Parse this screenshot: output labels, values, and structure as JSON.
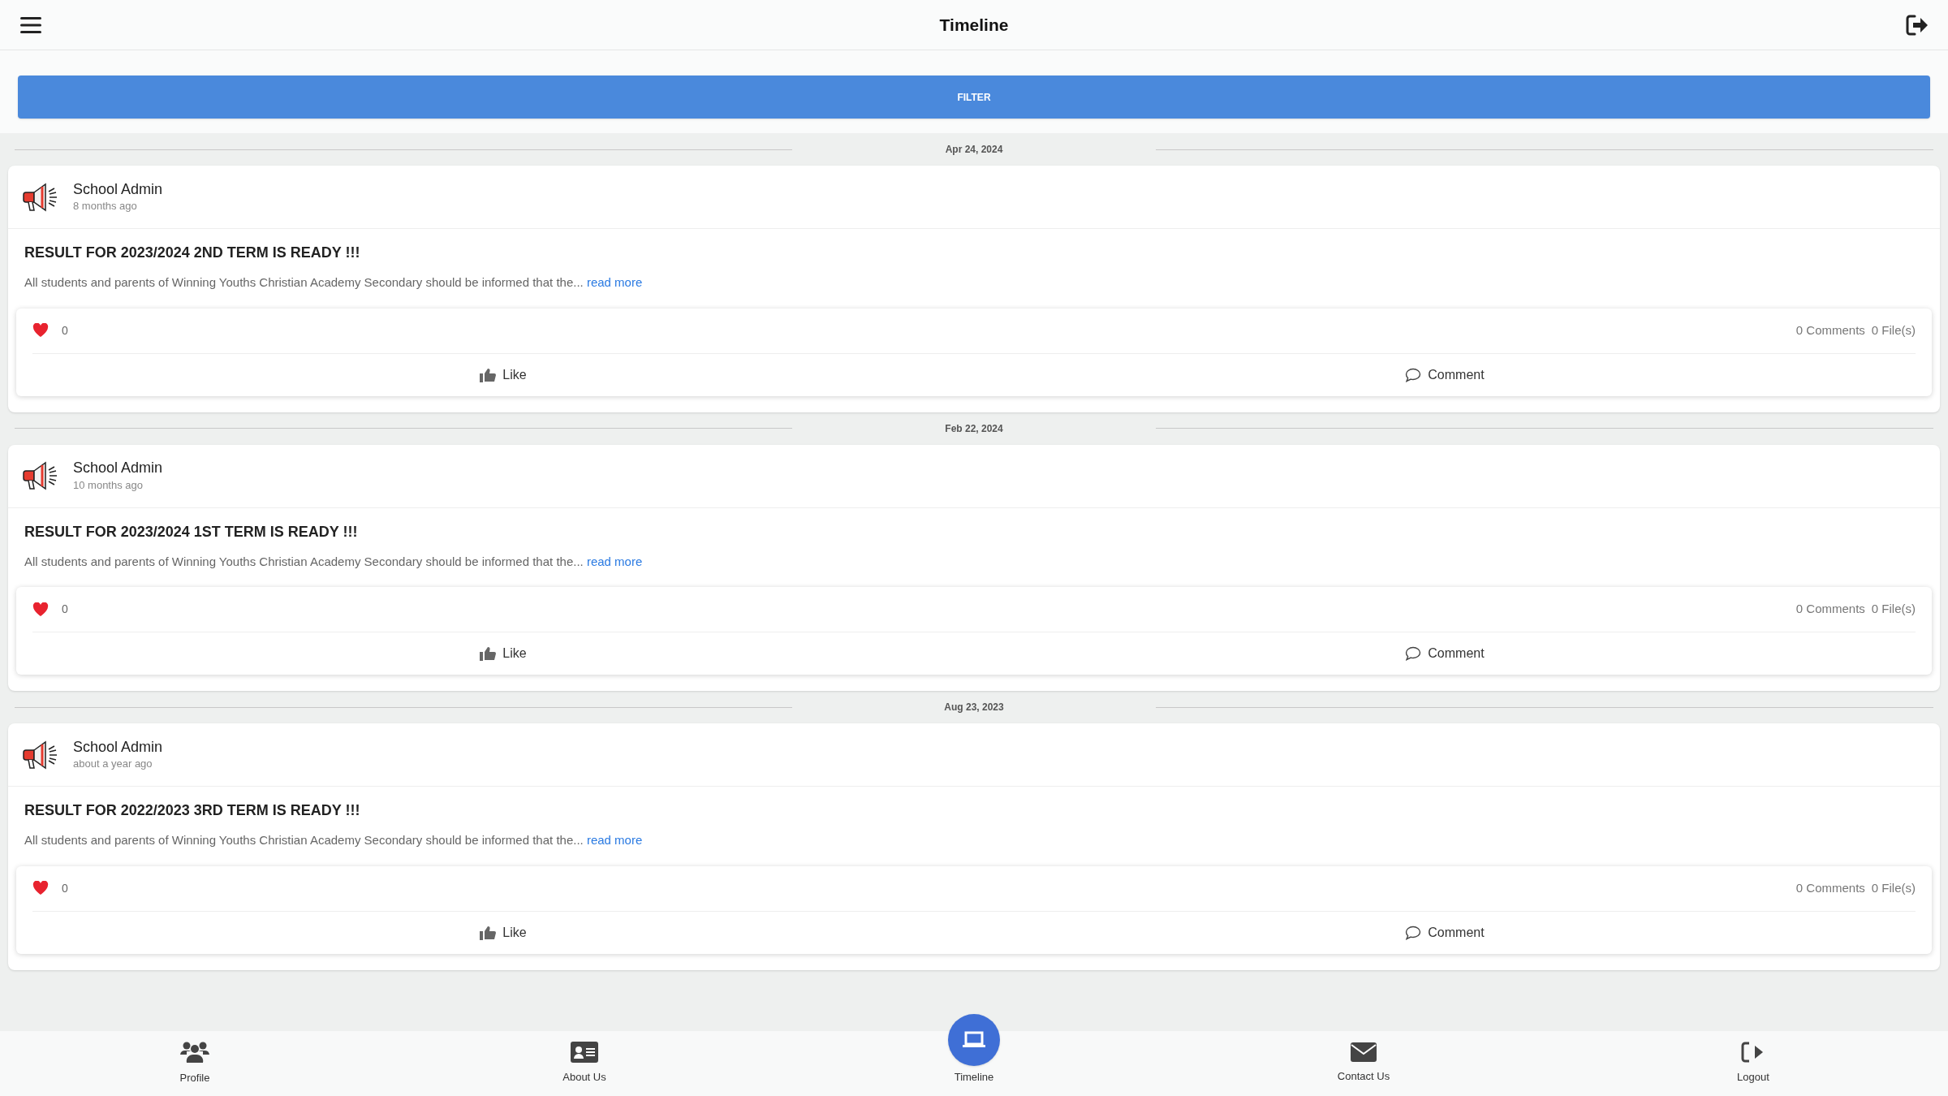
{
  "header": {
    "title": "Timeline"
  },
  "filter": {
    "label": "FILTER"
  },
  "posts": [
    {
      "date": "Apr 24, 2024",
      "author": "School Admin",
      "time": "8 months ago",
      "title": "RESULT FOR 2023/2024 2ND TERM IS READY !!!",
      "excerpt": "All students and parents of Winning Youths Christian Academy Secondary should be informed that the...",
      "read_more": "read more",
      "likes": "0",
      "comments": "0 Comments",
      "files": "0 File(s)",
      "like_label": "Like",
      "comment_label": "Comment"
    },
    {
      "date": "Feb 22, 2024",
      "author": "School Admin",
      "time": "10 months ago",
      "title": "RESULT FOR 2023/2024 1ST TERM IS READY !!!",
      "excerpt": "All students and parents of Winning Youths Christian Academy Secondary should be informed that the...",
      "read_more": "read more",
      "likes": "0",
      "comments": "0 Comments",
      "files": "0 File(s)",
      "like_label": "Like",
      "comment_label": "Comment"
    },
    {
      "date": "Aug 23, 2023",
      "author": "School Admin",
      "time": "about a year ago",
      "title": "RESULT FOR 2022/2023 3RD TERM IS READY !!!",
      "excerpt": "All students and parents of Winning Youths Christian Academy Secondary should be informed that the...",
      "read_more": "read more",
      "likes": "0",
      "comments": "0 Comments",
      "files": "0 File(s)",
      "like_label": "Like",
      "comment_label": "Comment"
    }
  ],
  "bottom_nav": [
    {
      "kind": "profile",
      "label": "Profile",
      "selected": false
    },
    {
      "kind": "about",
      "label": "About Us",
      "selected": false
    },
    {
      "kind": "timeline",
      "label": "Timeline",
      "selected": true
    },
    {
      "kind": "contact",
      "label": "Contact Us",
      "selected": false
    },
    {
      "kind": "logout",
      "label": "Logout",
      "selected": false
    }
  ]
}
